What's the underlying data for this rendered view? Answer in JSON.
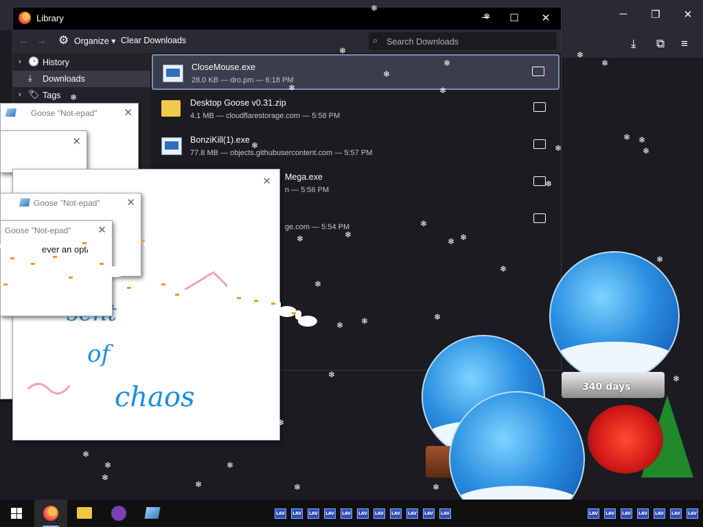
{
  "library": {
    "title": "Library",
    "toolbar": {
      "organize": "Organize",
      "clear": "Clear Downloads",
      "search_placeholder": "Search Downloads"
    },
    "sidebar": [
      {
        "label": "History",
        "icon": "clock-icon"
      },
      {
        "label": "Downloads",
        "icon": "download-icon",
        "selected": true
      },
      {
        "label": "Tags",
        "icon": "tag-icon"
      }
    ],
    "downloads": [
      {
        "name": "CloseMouse.exe",
        "meta": "28.0 KB — dro.pm — 6:18 PM",
        "type": "exe",
        "selected": true
      },
      {
        "name": "Desktop Goose v0.31.zip",
        "meta": "4.1 MB — cloudflarestorage.com — 5:58 PM",
        "type": "zip"
      },
      {
        "name": "BonziKill(1).exe",
        "meta": "77.8 MB — objects.githubusercontent.com — 5:57 PM",
        "type": "exe"
      },
      {
        "name": "Mega.exe",
        "meta": "n — 5:56 PM",
        "type": "exe"
      },
      {
        "name": "",
        "meta": "ge.com — 5:54 PM",
        "type": "exe"
      }
    ]
  },
  "notepads": {
    "title_a": "Goose \"Not-epad\"",
    "title_b": "Goose \"Not-epad\"",
    "title_c": "Goose \"Not-epad\"",
    "text_c": "ever an optio",
    "drawing": {
      "line1": "sent",
      "line2": "of",
      "line3": "chaos"
    }
  },
  "globes": {
    "label": "340 days"
  },
  "tray": {
    "tray_label": "LAV"
  }
}
